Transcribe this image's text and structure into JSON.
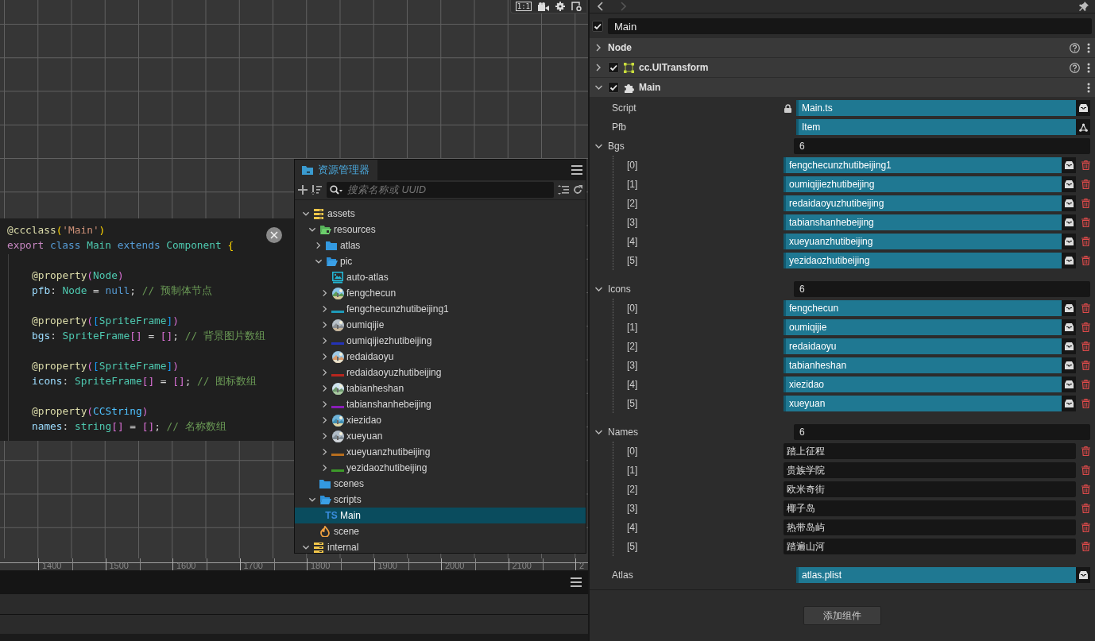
{
  "scene": {
    "toolbar": {
      "ratio_label": "1:1"
    },
    "ruler_labels": [
      "1400",
      "1500",
      "1600",
      "1700",
      "1800",
      "1900",
      "2000",
      "2100",
      "2"
    ]
  },
  "code_popup": {
    "blocks": [
      {
        "kind": "class",
        "lines": [
          [
            {
              "text": "@ccclass",
              "kind": "decorator"
            },
            {
              "text": "(",
              "kind": "bracket1"
            },
            {
              "text": "'Main'",
              "kind": "string"
            },
            {
              "text": ")",
              "kind": "bracket1"
            }
          ],
          [
            {
              "text": "export ",
              "kind": "keyword"
            },
            {
              "text": "class ",
              "kind": "storage"
            },
            {
              "text": "Main ",
              "kind": "type"
            },
            {
              "text": "extends ",
              "kind": "storage"
            },
            {
              "text": "Component ",
              "kind": "type"
            },
            {
              "text": "{",
              "kind": "bracket1"
            }
          ]
        ]
      },
      {
        "kind": "member",
        "lines": [
          [
            {
              "text": "@property",
              "kind": "decorator"
            },
            {
              "text": "(",
              "kind": "bracket2"
            },
            {
              "text": "Node",
              "kind": "type"
            },
            {
              "text": ")",
              "kind": "bracket2"
            }
          ],
          [
            {
              "text": "pfb",
              "kind": "variable"
            },
            {
              "text": ": ",
              "kind": "punctuation"
            },
            {
              "text": "Node",
              "kind": "type"
            },
            {
              "text": " = ",
              "kind": "punctuation"
            },
            {
              "text": "null",
              "kind": "storage"
            },
            {
              "text": "; ",
              "kind": "punctuation"
            },
            {
              "text": "// 预制体节点",
              "kind": "comment"
            }
          ]
        ]
      },
      {
        "kind": "member",
        "lines": [
          [
            {
              "text": "@property",
              "kind": "decorator"
            },
            {
              "text": "(",
              "kind": "bracket2"
            },
            {
              "text": "[",
              "kind": "bracket3"
            },
            {
              "text": "SpriteFrame",
              "kind": "type"
            },
            {
              "text": "]",
              "kind": "bracket3"
            },
            {
              "text": ")",
              "kind": "bracket2"
            }
          ],
          [
            {
              "text": "bgs",
              "kind": "variable"
            },
            {
              "text": ": ",
              "kind": "punctuation"
            },
            {
              "text": "SpriteFrame",
              "kind": "type"
            },
            {
              "text": "[]",
              "kind": "bracket2"
            },
            {
              "text": " = ",
              "kind": "punctuation"
            },
            {
              "text": "[]",
              "kind": "bracket2"
            },
            {
              "text": "; ",
              "kind": "punctuation"
            },
            {
              "text": "// 背景图片数组",
              "kind": "comment"
            }
          ]
        ]
      },
      {
        "kind": "member",
        "lines": [
          [
            {
              "text": "@property",
              "kind": "decorator"
            },
            {
              "text": "(",
              "kind": "bracket2"
            },
            {
              "text": "[",
              "kind": "bracket3"
            },
            {
              "text": "SpriteFrame",
              "kind": "type"
            },
            {
              "text": "]",
              "kind": "bracket3"
            },
            {
              "text": ")",
              "kind": "bracket2"
            }
          ],
          [
            {
              "text": "icons",
              "kind": "variable"
            },
            {
              "text": ": ",
              "kind": "punctuation"
            },
            {
              "text": "SpriteFrame",
              "kind": "type"
            },
            {
              "text": "[]",
              "kind": "bracket2"
            },
            {
              "text": " = ",
              "kind": "punctuation"
            },
            {
              "text": "[]",
              "kind": "bracket2"
            },
            {
              "text": "; ",
              "kind": "punctuation"
            },
            {
              "text": "// 图标数组",
              "kind": "comment"
            }
          ]
        ]
      },
      {
        "kind": "member",
        "lines": [
          [
            {
              "text": "@property",
              "kind": "decorator"
            },
            {
              "text": "(",
              "kind": "bracket2"
            },
            {
              "text": "CCString",
              "kind": "class"
            },
            {
              "text": ")",
              "kind": "bracket2"
            }
          ],
          [
            {
              "text": "names",
              "kind": "variable"
            },
            {
              "text": ": ",
              "kind": "punctuation"
            },
            {
              "text": "string",
              "kind": "type"
            },
            {
              "text": "[]",
              "kind": "bracket2"
            },
            {
              "text": " = ",
              "kind": "punctuation"
            },
            {
              "text": "[]",
              "kind": "bracket2"
            },
            {
              "text": "; ",
              "kind": "punctuation"
            },
            {
              "text": "// 名称数组",
              "kind": "comment"
            }
          ]
        ]
      }
    ]
  },
  "assets_panel": {
    "tab": {
      "label": "资源管理器",
      "selected": true
    },
    "search": {
      "placeholder": "搜索名称或 UUID"
    },
    "tree": [
      {
        "label": "assets",
        "kind": "bundle",
        "expanded": true,
        "selected": false,
        "children": [
          {
            "label": "resources",
            "kind": "resources",
            "expanded": true,
            "selected": false,
            "children": [
              {
                "label": "atlas",
                "kind": "folder",
                "expanded": false,
                "selected": false
              },
              {
                "label": "pic",
                "kind": "folder",
                "expanded": true,
                "selected": false,
                "children": [
                  {
                    "label": "auto-atlas",
                    "kind": "atlas",
                    "selected": false
                  },
                  {
                    "label": "fengchecun",
                    "kind": "sprite",
                    "expanded": false,
                    "selected": false
                  },
                  {
                    "label": "fengchecunzhutibeijing1",
                    "kind": "texture",
                    "color": "#1e9ab8",
                    "expanded": false,
                    "selected": false
                  },
                  {
                    "label": "oumiqijie",
                    "kind": "sprite",
                    "expanded": false,
                    "selected": false
                  },
                  {
                    "label": "oumiqijiezhutibeijing",
                    "kind": "texture",
                    "color": "#2433b8",
                    "expanded": false,
                    "selected": false
                  },
                  {
                    "label": "redaidaoyu",
                    "kind": "sprite",
                    "expanded": false,
                    "selected": false
                  },
                  {
                    "label": "redaidaoyuzhutibeijing",
                    "kind": "texture",
                    "color": "#b8261e",
                    "expanded": false,
                    "selected": false
                  },
                  {
                    "label": "tabianheshan",
                    "kind": "sprite",
                    "expanded": false,
                    "selected": false
                  },
                  {
                    "label": "tabianshanhebeijing",
                    "kind": "texture",
                    "color": "#8a1eb8",
                    "expanded": false,
                    "selected": false
                  },
                  {
                    "label": "xiezidao",
                    "kind": "sprite",
                    "expanded": false,
                    "selected": false
                  },
                  {
                    "label": "xueyuan",
                    "kind": "sprite",
                    "expanded": false,
                    "selected": false
                  },
                  {
                    "label": "xueyuanzhutibeijing",
                    "kind": "texture",
                    "color": "#b86e1e",
                    "expanded": false,
                    "selected": false
                  },
                  {
                    "label": "yezidaozhutibeijing",
                    "kind": "texture",
                    "color": "#3d9a2a",
                    "expanded": false,
                    "selected": false
                  }
                ]
              }
            ]
          },
          {
            "label": "scenes",
            "kind": "folder",
            "selected": false
          },
          {
            "label": "scripts",
            "kind": "folder",
            "expanded": true,
            "selected": false,
            "children": [
              {
                "label": "Main",
                "kind": "script",
                "badge": "TS",
                "selected": true
              }
            ]
          },
          {
            "label": "scene",
            "kind": "scene",
            "selected": false
          }
        ]
      },
      {
        "label": "internal",
        "kind": "bundle",
        "expanded": true,
        "selected": false
      }
    ]
  },
  "inspector": {
    "node": {
      "active": true,
      "name": "Main"
    },
    "components": [
      {
        "title": "Node",
        "kind": "node",
        "expanded": false
      },
      {
        "title": "cc.UITransform",
        "kind": "transform",
        "enabled": true,
        "expanded": false
      },
      {
        "title": "Main",
        "kind": "script",
        "enabled": true,
        "expanded": true
      }
    ],
    "properties": [
      {
        "kind": "script",
        "label": "Script",
        "value": "Main.ts",
        "locked": true
      },
      {
        "kind": "prefab",
        "label": "Pfb",
        "value": "Item",
        "locked": false
      },
      {
        "kind": "array",
        "label": "Bgs",
        "count": "6",
        "expanded": true,
        "items": [
          {
            "kind": "sprite",
            "index": "[0]",
            "value": "fengchecunzhutibeijing1"
          },
          {
            "kind": "sprite",
            "index": "[1]",
            "value": "oumiqijiezhutibeijing"
          },
          {
            "kind": "sprite",
            "index": "[2]",
            "value": "redaidaoyuzhutibeijing"
          },
          {
            "kind": "sprite",
            "index": "[3]",
            "value": "tabianshanhebeijing"
          },
          {
            "kind": "sprite",
            "index": "[4]",
            "value": "xueyuanzhutibeijing"
          },
          {
            "kind": "sprite",
            "index": "[5]",
            "value": "yezidaozhutibeijing"
          }
        ]
      },
      {
        "kind": "array",
        "label": "Icons",
        "count": "6",
        "expanded": true,
        "items": [
          {
            "kind": "sprite",
            "index": "[0]",
            "value": "fengchecun"
          },
          {
            "kind": "sprite",
            "index": "[1]",
            "value": "oumiqijie"
          },
          {
            "kind": "sprite",
            "index": "[2]",
            "value": "redaidaoyu"
          },
          {
            "kind": "sprite",
            "index": "[3]",
            "value": "tabianheshan"
          },
          {
            "kind": "sprite",
            "index": "[4]",
            "value": "xiezidao"
          },
          {
            "kind": "sprite",
            "index": "[5]",
            "value": "xueyuan"
          }
        ]
      },
      {
        "kind": "array",
        "label": "Names",
        "count": "6",
        "expanded": true,
        "items": [
          {
            "kind": "text",
            "index": "[0]",
            "value": "踏上征程"
          },
          {
            "kind": "text",
            "index": "[1]",
            "value": "贵族学院"
          },
          {
            "kind": "text",
            "index": "[2]",
            "value": "欧米奇街"
          },
          {
            "kind": "text",
            "index": "[3]",
            "value": "椰子岛"
          },
          {
            "kind": "text",
            "index": "[4]",
            "value": "热带岛屿"
          },
          {
            "kind": "text",
            "index": "[5]",
            "value": "踏遍山河"
          }
        ]
      },
      {
        "kind": "atlas",
        "label": "Atlas",
        "value": "atlas.plist",
        "locked": false
      }
    ],
    "add_button": "添加组件"
  }
}
